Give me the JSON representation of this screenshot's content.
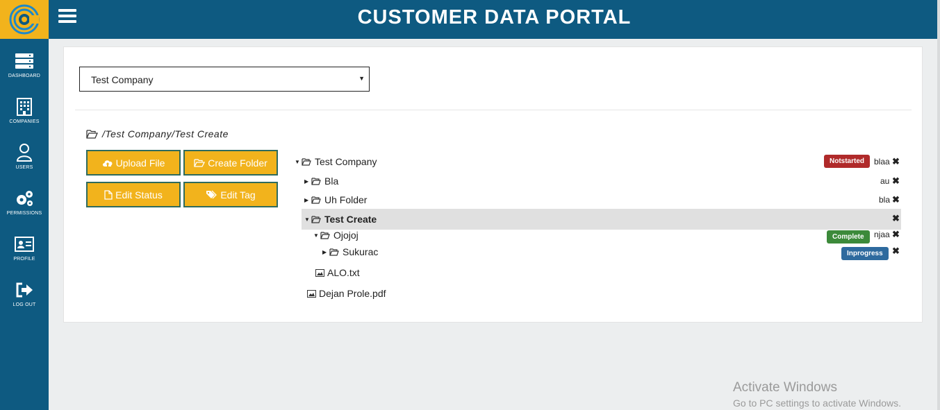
{
  "header": {
    "title": "CUSTOMER DATA PORTAL"
  },
  "sidebar": {
    "items": [
      {
        "label": "DASHBOARD",
        "icon": "server-icon"
      },
      {
        "label": "COMPANIES",
        "icon": "building-icon"
      },
      {
        "label": "USERS",
        "icon": "user-icon"
      },
      {
        "label": "PERMISSIONS",
        "icon": "gears-icon"
      },
      {
        "label": "PROFILE",
        "icon": "id-card-icon"
      },
      {
        "label": "LOG OUT",
        "icon": "sign-out-icon"
      }
    ]
  },
  "company_select": {
    "value": "Test Company"
  },
  "path": "/Test Company/Test Create",
  "actions": {
    "upload": "Upload File",
    "create_folder": "Create Folder",
    "edit_status": "Edit Status",
    "edit_tag": "Edit Tag"
  },
  "tree": {
    "root": {
      "name": "Test Company",
      "status": "Notstarted",
      "tag": "blaa"
    },
    "bla": {
      "name": "Bla",
      "tag": "au"
    },
    "uh_folder": {
      "name": "Uh Folder",
      "tag": "bla"
    },
    "test_create": {
      "name": "Test Create"
    },
    "ojojoj": {
      "name": "Ojojoj",
      "status": "Complete",
      "tag": "njaa"
    },
    "sukurac": {
      "name": "Sukurac",
      "status": "Inprogress"
    },
    "alo": {
      "name": "ALO.txt"
    },
    "dejan": {
      "name": "Dejan Prole.pdf"
    }
  },
  "delete_glyph": "✖",
  "watermark": {
    "line1": "Activate Windows",
    "line2": "Go to PC settings to activate Windows."
  },
  "colors": {
    "primary": "#0e5a81",
    "accent": "#f2b31c",
    "status_notstarted": "#b02a2a",
    "status_complete": "#3c8a3a",
    "status_inprogress": "#2e6a9e"
  }
}
